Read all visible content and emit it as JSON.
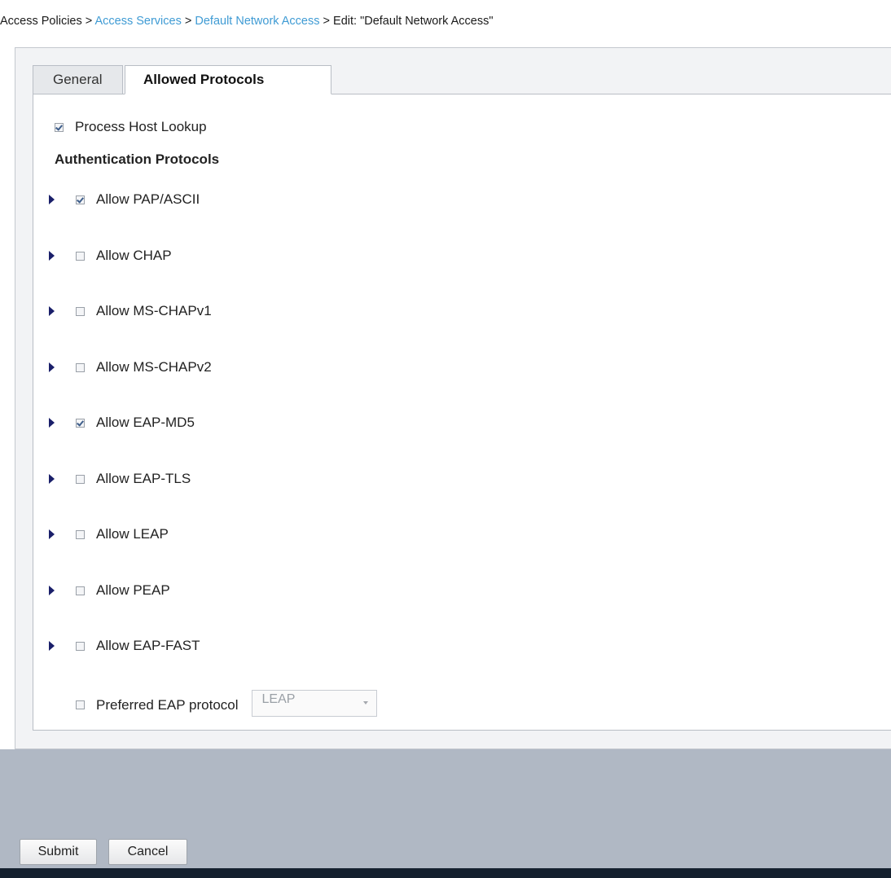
{
  "breadcrumb": {
    "item1": "Access Policies",
    "sep1": " > ",
    "item2": "Access Services",
    "sep2": " > ",
    "item3": "Default Network Access",
    "sep3": " > ",
    "item4": "Edit: \"Default Network Access\""
  },
  "tabs": {
    "general": "General",
    "allowed": "Allowed Protocols"
  },
  "process_host_lookup": {
    "label": "Process Host Lookup",
    "checked": true
  },
  "section_title": "Authentication Protocols",
  "protocols": [
    {
      "label": "Allow PAP/ASCII",
      "checked": true
    },
    {
      "label": "Allow CHAP",
      "checked": false
    },
    {
      "label": "Allow MS-CHAPv1",
      "checked": false
    },
    {
      "label": "Allow MS-CHAPv2",
      "checked": false
    },
    {
      "label": "Allow EAP-MD5",
      "checked": true
    },
    {
      "label": "Allow EAP-TLS",
      "checked": false
    },
    {
      "label": "Allow LEAP",
      "checked": false
    },
    {
      "label": "Allow PEAP",
      "checked": false
    },
    {
      "label": "Allow EAP-FAST",
      "checked": false
    }
  ],
  "preferred_eap": {
    "label": "Preferred EAP protocol",
    "checked": false,
    "selected": "LEAP"
  },
  "buttons": {
    "submit": "Submit",
    "cancel": "Cancel"
  },
  "colors": {
    "link": "#3f9bd4",
    "expand_arrow": "#1a1f6a",
    "footer": "#b0b8c4",
    "bottom_bar": "#14202e"
  },
  "icons": {
    "expand": "triangle-right-icon",
    "dropdown": "chevron-down-icon"
  }
}
